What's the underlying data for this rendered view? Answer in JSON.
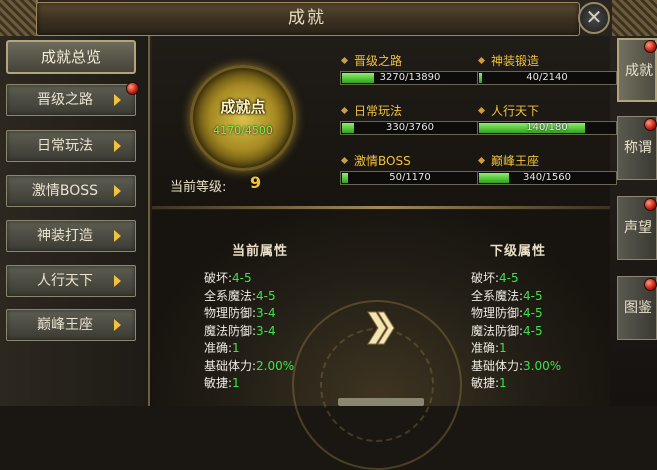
{
  "window": {
    "title": "成就",
    "close_glyph": "✕"
  },
  "sidebar": {
    "main_label": "成就总览",
    "items": [
      {
        "label": "晋级之路",
        "alert": true
      },
      {
        "label": "日常玩法",
        "alert": false
      },
      {
        "label": "激情BOSS",
        "alert": false
      },
      {
        "label": "神装打造",
        "alert": false
      },
      {
        "label": "人行天下",
        "alert": false
      },
      {
        "label": "巅峰王座",
        "alert": false
      }
    ]
  },
  "right_tabs": [
    {
      "label": "成就",
      "active": true,
      "alert": true
    },
    {
      "label": "称谓",
      "active": false,
      "alert": true
    },
    {
      "label": "声望",
      "active": false,
      "alert": true
    },
    {
      "label": "图鉴",
      "active": false,
      "alert": true
    }
  ],
  "medal": {
    "title": "成就点",
    "value_text": "4170/4500"
  },
  "level": {
    "label": "当前等级:",
    "value": "9"
  },
  "categories": [
    {
      "name": "晋级之路",
      "current": 3270,
      "max": 13890,
      "text": "3270/13890"
    },
    {
      "name": "神装锻造",
      "current": 40,
      "max": 2140,
      "text": "40/2140"
    },
    {
      "name": "日常玩法",
      "current": 330,
      "max": 3760,
      "text": "330/3760"
    },
    {
      "name": "人行天下",
      "current": 140,
      "max": 180,
      "text": "140/180"
    },
    {
      "name": "激情BOSS",
      "current": 50,
      "max": 1170,
      "text": "50/1170"
    },
    {
      "name": "巅峰王座",
      "current": 340,
      "max": 1560,
      "text": "340/1560"
    }
  ],
  "current_attrs": {
    "title": "当前属性",
    "rows": [
      {
        "k": "破坏:",
        "v": "4-5"
      },
      {
        "k": "全系魔法:",
        "v": "4-5"
      },
      {
        "k": "物理防御:",
        "v": "3-4"
      },
      {
        "k": "魔法防御:",
        "v": "3-4"
      },
      {
        "k": "准确:",
        "v": "1"
      },
      {
        "k": "基础体力:",
        "v": "2.00%"
      },
      {
        "k": "敏捷:",
        "v": "1"
      }
    ]
  },
  "next_attrs": {
    "title": "下级属性",
    "rows": [
      {
        "k": "破坏:",
        "v": "4-5"
      },
      {
        "k": "全系魔法:",
        "v": "4-5"
      },
      {
        "k": "物理防御:",
        "v": "4-5"
      },
      {
        "k": "魔法防御:",
        "v": "4-5"
      },
      {
        "k": "准确:",
        "v": "1"
      },
      {
        "k": "基础体力:",
        "v": "3.00%"
      },
      {
        "k": "敏捷:",
        "v": "1"
      }
    ]
  },
  "colors": {
    "accent_gold": "#f2c23a",
    "value_green": "#3fe34a",
    "bar_green": "#2fa21e"
  }
}
